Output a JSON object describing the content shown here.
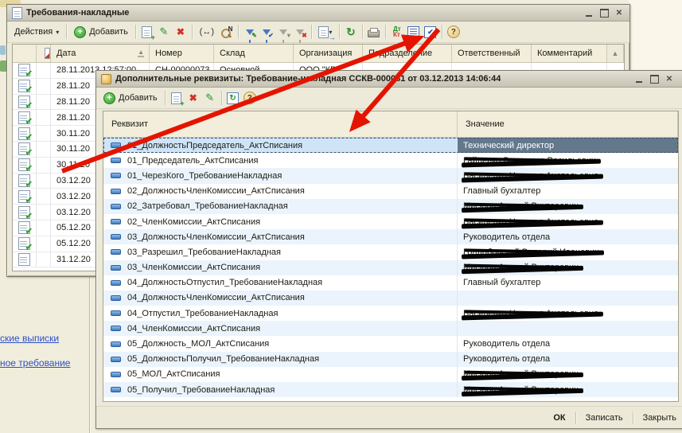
{
  "icons": {
    "plus": "+",
    "caret_down": "▾",
    "edit": "✎",
    "delete": "✖",
    "interval": "(↔)",
    "find_letter": "N",
    "refresh": "↻",
    "check": "✔",
    "double_check": "✔✔",
    "help": "?",
    "scroll_up": "▲",
    "close": "✕",
    "sort": "▲",
    "dt": "Дт",
    "kt": "Кт"
  },
  "main_window": {
    "title": "Требования-накладные",
    "toolbar": {
      "actions_label": "Действия",
      "add_label": "Добавить"
    },
    "table": {
      "columns": [
        "Дата",
        "Номер",
        "Склад",
        "Организация",
        "Подразделение",
        "Ответственный",
        "Комментарий"
      ],
      "rows": [
        {
          "date": "28.11.2013 12:57:00",
          "number": "СН-00000073",
          "warehouse": "Основной",
          "organization": "ООО \"КВ",
          "posted": true
        },
        {
          "date": "28.11.20",
          "posted": true
        },
        {
          "date": "28.11.20",
          "posted": true
        },
        {
          "date": "28.11.20",
          "posted": true
        },
        {
          "date": "30.11.20",
          "posted": true
        },
        {
          "date": "30.11.20",
          "posted": true
        },
        {
          "date": "30.11.20",
          "posted": true
        },
        {
          "date": "03.12.20",
          "posted": true
        },
        {
          "date": "03.12.20",
          "posted": true
        },
        {
          "date": "03.12.20",
          "posted": true
        },
        {
          "date": "05.12.20",
          "posted": true
        },
        {
          "date": "05.12.20",
          "posted": true
        },
        {
          "date": "31.12.20",
          "posted": false
        }
      ]
    }
  },
  "dialog": {
    "title": "Дополнительные реквизиты: Требование-накладная ССКВ-000081 от 03.12.2013 14:06:44",
    "toolbar": {
      "add_label": "Добавить"
    },
    "table": {
      "columns": [
        "Реквизит",
        "Значение"
      ],
      "rows": [
        {
          "name": "01_ДолжностьПредседатель_АктСписания",
          "value": "Технический директор",
          "selected": true,
          "redacted": false
        },
        {
          "name": "01_Председатель_АктСписания",
          "value": "Гайденко Владимир Васильевич",
          "redacted": true
        },
        {
          "name": "01_ЧерезКого_ТребованиеНакладная",
          "value": "Василенко Наталья Анатольевна",
          "redacted": true
        },
        {
          "name": "02_ДолжностьЧленКомиссии_АктСписания",
          "value": "Главный бухгалтер",
          "redacted": false
        },
        {
          "name": "02_Затребовал_ТребованиеНакладная",
          "value": "Мисюра Андрей Викторович",
          "redacted": true
        },
        {
          "name": "02_ЧленКомиссии_АктСписания",
          "value": "Василенко Наталья Анатольевна",
          "redacted": true
        },
        {
          "name": "03_ДолжностьЧленКомиссии_АктСписания",
          "value": "Руководитель отдела",
          "redacted": false
        },
        {
          "name": "03_Разрешил_ТребованиеНакладная",
          "value": "Голдобовский Валерий Иванович",
          "redacted": true
        },
        {
          "name": "03_ЧленКомиссии_АктСписания",
          "value": "Мисюра Андрей Викторович",
          "redacted": true
        },
        {
          "name": "04_ДолжностьОтпустил_ТребованиеНакладная",
          "value": "Главный бухгалтер",
          "redacted": false
        },
        {
          "name": "04_ДолжностьЧленКомиссии_АктСписания",
          "value": "",
          "redacted": false
        },
        {
          "name": "04_Отпустил_ТребованиеНакладная",
          "value": "Василенко Наталья Анатольевна",
          "redacted": true
        },
        {
          "name": "04_ЧленКомиссии_АктСписания",
          "value": "",
          "redacted": false
        },
        {
          "name": "05_Должность_МОЛ_АктСписания",
          "value": "Руководитель отдела",
          "redacted": false
        },
        {
          "name": "05_ДолжностьПолучил_ТребованиеНакладная",
          "value": "Руководитель отдела",
          "redacted": false
        },
        {
          "name": "05_МОЛ_АктСписания",
          "value": "Мисюра Андрей Викторович",
          "redacted": true
        },
        {
          "name": "05_Получил_ТребованиеНакладная",
          "value": "Мисюра Андрей Викторович",
          "redacted": true
        }
      ]
    },
    "buttons": {
      "ok": "ОК",
      "write": "Записать",
      "close": "Закрыть"
    }
  },
  "sidebar_links": [
    "ские выписки",
    "ное требование"
  ],
  "annotations": {
    "arrow_color": "#E51400"
  }
}
